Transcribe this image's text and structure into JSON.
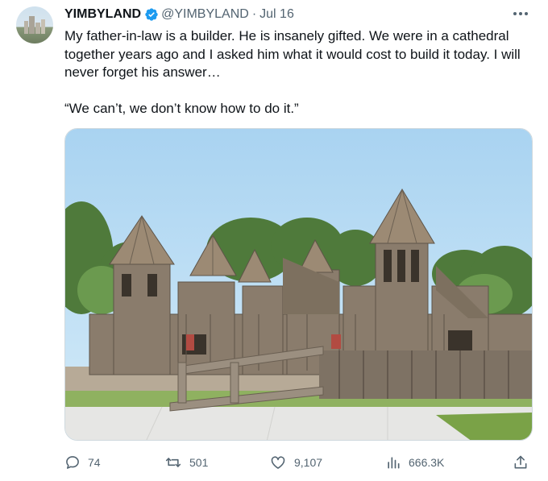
{
  "author": {
    "name": "YIMBYLAND",
    "handle": "@YIMBYLAND",
    "separator": "·",
    "date": "Jul 16",
    "verified": true
  },
  "tweet": {
    "text": "My father-in-law is a builder. He is insanely gifted. We were in a cathedral together years ago and I asked him what it would cost to build it today. I will never forget his answer…\n\n“We can’t, we don’t know how to do it.”"
  },
  "media": {
    "kind": "photo",
    "subject": "wooden castle playground"
  },
  "stats": {
    "replies": "74",
    "reposts": "501",
    "likes": "9,107",
    "views": "666.3K"
  },
  "colors": {
    "text": "#0f1419",
    "secondary": "#536471",
    "verified_badge": "#1d9bf0",
    "sky": "#b9dcf3",
    "wood": "#8a7c6c"
  },
  "icons": {
    "more": "more-icon",
    "reply": "reply-icon",
    "repost": "repost-icon",
    "like": "like-icon",
    "views": "views-icon",
    "share": "share-icon"
  }
}
